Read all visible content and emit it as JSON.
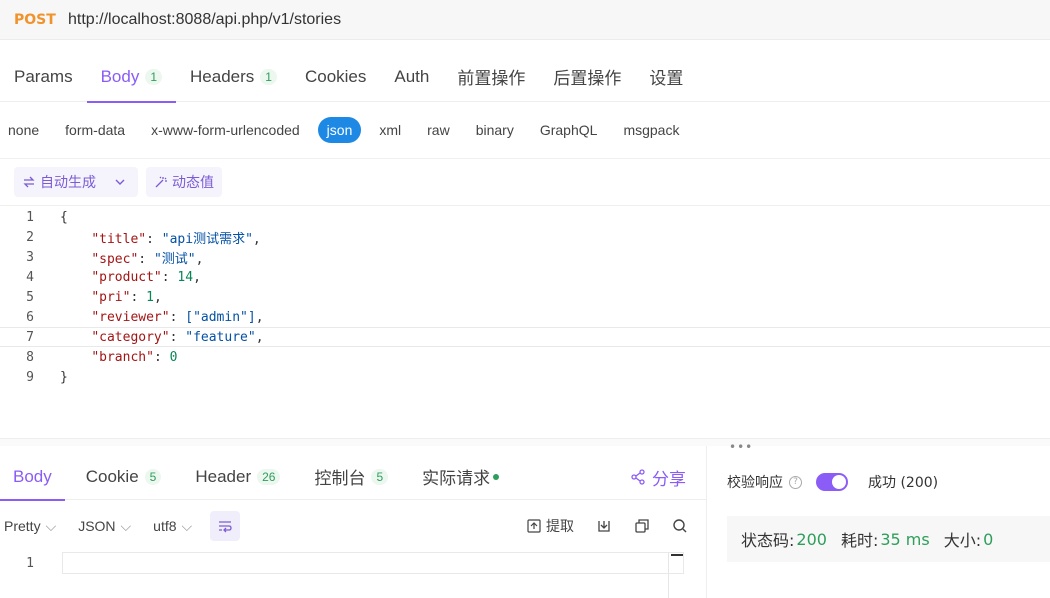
{
  "request": {
    "method": "POST",
    "url": "http://localhost:8088/api.php/v1/stories"
  },
  "req_tabs": [
    {
      "label": "Params"
    },
    {
      "label": "Body",
      "count": "1"
    },
    {
      "label": "Headers",
      "count": "1"
    },
    {
      "label": "Cookies"
    },
    {
      "label": "Auth"
    },
    {
      "label": "前置操作"
    },
    {
      "label": "后置操作"
    },
    {
      "label": "设置"
    }
  ],
  "body_types": [
    "none",
    "form-data",
    "x-www-form-urlencoded",
    "json",
    "xml",
    "raw",
    "binary",
    "GraphQL",
    "msgpack"
  ],
  "body_type_selected": "json",
  "body_toolbar": {
    "auto_generate": "自动生成",
    "dynamic_value": "动态值"
  },
  "editor": {
    "lines": [
      {
        "n": "1",
        "text": "{"
      },
      {
        "n": "2",
        "key": "\"title\"",
        "value": "\"api测试需求\"",
        "type": "string",
        "trail": ","
      },
      {
        "n": "3",
        "key": "\"spec\"",
        "value": "\"测试\"",
        "type": "string",
        "trail": ","
      },
      {
        "n": "4",
        "key": "\"product\"",
        "value": "14",
        "type": "number",
        "trail": ","
      },
      {
        "n": "5",
        "key": "\"pri\"",
        "value": "1",
        "type": "number",
        "trail": ","
      },
      {
        "n": "6",
        "key": "\"reviewer\"",
        "value": "[\"admin\"]",
        "type": "array",
        "trail": ","
      },
      {
        "n": "7",
        "key": "\"category\"",
        "value": "\"feature\"",
        "type": "string",
        "trail": ","
      },
      {
        "n": "8",
        "key": "\"branch\"",
        "value": "0",
        "type": "number",
        "trail": ""
      },
      {
        "n": "9",
        "text": "}"
      }
    ]
  },
  "response": {
    "tabs": [
      {
        "label": "Body"
      },
      {
        "label": "Cookie",
        "count": "5"
      },
      {
        "label": "Header",
        "count": "26"
      },
      {
        "label": "控制台",
        "count": "5"
      },
      {
        "label": "实际请求"
      }
    ],
    "share_label": "分享",
    "format_options": [
      "Pretty",
      "JSON",
      "utf8"
    ],
    "extract_label": "提取",
    "line_number": "1"
  },
  "validation": {
    "label": "校验响应",
    "result": "成功 (200)",
    "enabled": true
  },
  "status": {
    "code_label": "状态码:",
    "code": "200",
    "time_label": "耗时:",
    "time": "35 ms",
    "size_label": "大小:",
    "size": "0"
  },
  "colors": {
    "accent": "#8b5cf6",
    "method": "#f0932b",
    "json_selected": "#1e88e5",
    "success": "#2e9e5b"
  }
}
